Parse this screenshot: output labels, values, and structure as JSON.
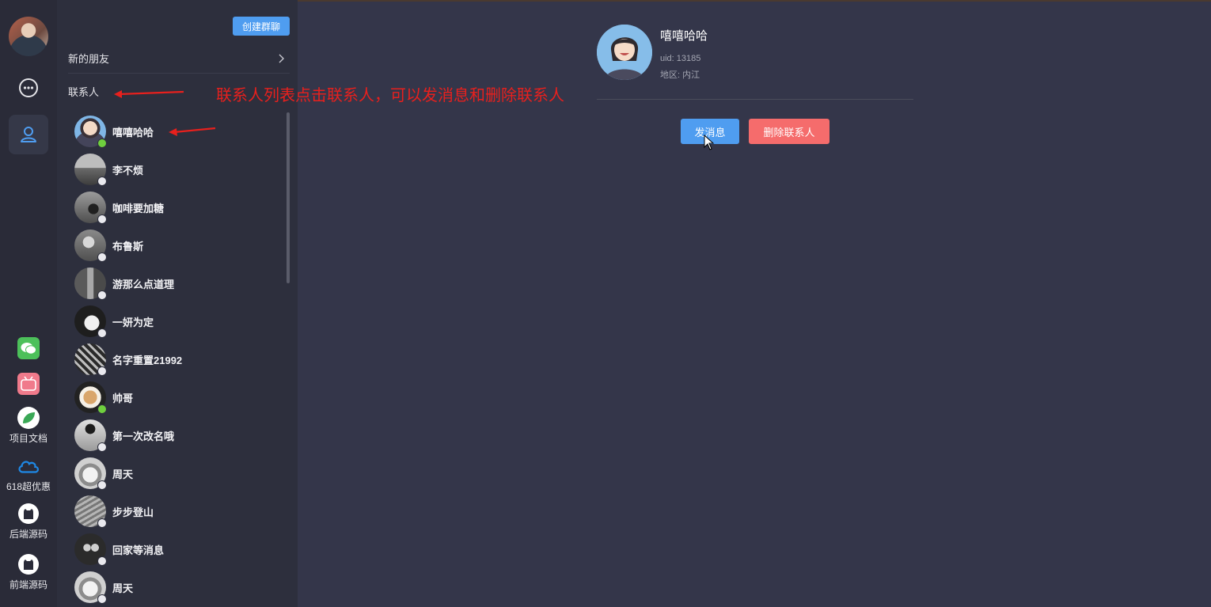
{
  "sidebar_tools": [
    {
      "icon": "wechat-icon",
      "label": ""
    },
    {
      "icon": "bilibili-icon",
      "label": ""
    },
    {
      "icon": "leaf-docs-icon",
      "label": "项目文档"
    },
    {
      "icon": "cloud-icon",
      "label": "618超优惠"
    },
    {
      "icon": "github-icon",
      "label": "后端源码"
    },
    {
      "icon": "github-icon",
      "label": "前端源码"
    }
  ],
  "panel": {
    "create_group_label": "创建群聊",
    "new_friends_label": "新的朋友",
    "contacts_title": "联系人"
  },
  "contacts": [
    {
      "name": "嘻嘻哈哈",
      "online": true
    },
    {
      "name": "李不烦",
      "online": false
    },
    {
      "name": "咖啡要加糖",
      "online": false
    },
    {
      "name": "布鲁斯",
      "online": false
    },
    {
      "name": "游那么点道理",
      "online": false
    },
    {
      "name": "一妍为定",
      "online": false
    },
    {
      "name": "名字重置21992",
      "online": false
    },
    {
      "name": "帅哥",
      "online": true
    },
    {
      "name": "第一次改名哦",
      "online": false
    },
    {
      "name": "周天",
      "online": false
    },
    {
      "name": "步步登山",
      "online": false
    },
    {
      "name": "回家等消息",
      "online": false
    },
    {
      "name": "周天",
      "online": false
    }
  ],
  "annotation": "联系人列表点击联系人，可以发消息和删除联系人",
  "detail": {
    "name": "嘻嘻哈哈",
    "uid": "uid: 13185",
    "region": "地区: 内江",
    "send_label": "发消息",
    "delete_label": "删除联系人"
  },
  "colors": {
    "accent": "#4f9df0",
    "danger": "#f56c6c",
    "online": "#6fcf3e",
    "annotation": "#e8201d"
  }
}
